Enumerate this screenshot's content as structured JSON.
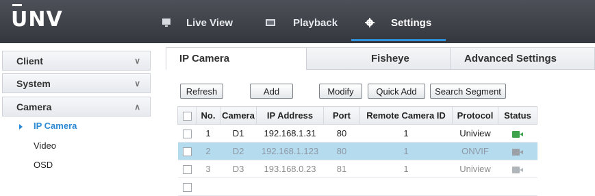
{
  "app": {
    "logo": "UNV"
  },
  "nav": [
    {
      "label": "Live View",
      "icon": "monitor-icon"
    },
    {
      "label": "Playback",
      "icon": "film-icon"
    },
    {
      "label": "Settings",
      "icon": "gear-icon"
    }
  ],
  "sidebar": {
    "sections": [
      {
        "label": "Client",
        "icon": "chevron-double-down-icon"
      },
      {
        "label": "System",
        "icon": "chevron-double-down-icon"
      },
      {
        "label": "Camera",
        "icon": "chevron-double-up-icon"
      }
    ],
    "items": [
      "IP Camera",
      "Video",
      "OSD"
    ]
  },
  "tabs": [
    "IP Camera",
    "Fisheye",
    "Advanced Settings"
  ],
  "toolbar": {
    "refresh": "Refresh",
    "add": "Add",
    "modify": "Modify",
    "quick_add": "Quick Add",
    "search_segment": "Search Segment"
  },
  "table": {
    "headers": [
      "No.",
      "Camera",
      "IP Address",
      "Port",
      "Remote Camera ID",
      "Protocol",
      "Status"
    ],
    "rows": [
      {
        "no": "1",
        "camera": "D1",
        "ip": "192.168.1.31",
        "port": "80",
        "remote_id": "1",
        "protocol": "Uniview",
        "status": "online"
      },
      {
        "no": "2",
        "camera": "D2",
        "ip": "192.168.1.123",
        "port": "80",
        "remote_id": "1",
        "protocol": "ONVIF",
        "status": "offline"
      },
      {
        "no": "3",
        "camera": "D3",
        "ip": "193.168.0.23",
        "port": "81",
        "remote_id": "1",
        "protocol": "Uniview",
        "status": "offline"
      }
    ]
  },
  "colors": {
    "accent": "#2a88d4",
    "selected_row": "#b5dbee",
    "online": "#3fa34d",
    "offline": "#9aa0a6"
  }
}
